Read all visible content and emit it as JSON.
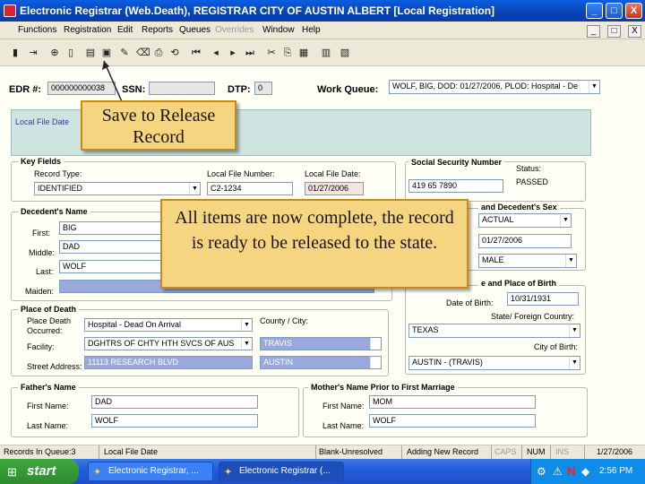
{
  "window": {
    "title": "Electronic Registrar (Web.Death), REGISTRAR   CITY OF AUSTIN   ALBERT   [Local Registration]",
    "min_label": "_",
    "max_label": "□",
    "close_label": "X",
    "mdi_min": "_",
    "mdi_max": "□",
    "mdi_close": "X"
  },
  "menu": [
    "Functions",
    "Registration",
    "Edit",
    "Reports",
    "Queues",
    "Overrides",
    "Window",
    "Help"
  ],
  "header": {
    "edr_label": "EDR #:",
    "edr_value": "000000000038",
    "ssn_label": "SSN:",
    "dtp_label": "DTP:",
    "dtp_value": "0",
    "work_queue_label": "Work Queue:",
    "work_queue_value": "WOLF, BIG, DOD: 01/27/2006, PLOD: Hospital - De"
  },
  "local_file_date_tab": "Local File Date",
  "key_fields": {
    "title": "Key Fields",
    "record_type_label": "Record Type:",
    "record_type_value": "IDENTIFIED",
    "local_file_number_label": "Local File Number:",
    "local_file_number_value": "C2-1234",
    "local_file_date_label": "Local File Date:",
    "local_file_date_value": "01/27/2006"
  },
  "ssn_group": {
    "title": "Social Security Number",
    "value": "419 65 7890",
    "status_label": "Status:",
    "status_value": "PASSED"
  },
  "decedent_name": {
    "title": "Decedent's Name",
    "first_label": "First:",
    "first_value": "BIG",
    "middle_label": "Middle:",
    "middle_value": "DAD",
    "last_label": "Last:",
    "last_value": "WOLF",
    "maiden_label": "Maiden:"
  },
  "sex_group": {
    "title": "and Decedent's Sex",
    "value1": "ACTUAL",
    "value2": "01/27/2006",
    "value3": "MALE"
  },
  "birth_group": {
    "title": "e and Place of Birth",
    "dob_label": "Date of Birth:",
    "dob_value": "10/31/1931",
    "state_label": "State/ Foreign Country:",
    "state_value": "TEXAS",
    "city_label": "City of Birth:",
    "city_value": "AUSTIN - (TRAVIS)"
  },
  "place_of_death": {
    "title": "Place of Death",
    "occurred_label": "Place Death Occurred:",
    "occurred_value": "Hospital - Dead On Arrival",
    "facility_label": "Facility:",
    "facility_value": "DGHTRS OF CHTY HTH SVCS OF AUS",
    "county_label": "County / City:",
    "county_value": "TRAVIS",
    "city_value": "AUSTIN",
    "street_label": "Street Address:",
    "street_value": "11113 RESEARCH BLVD"
  },
  "father": {
    "title": "Father's Name",
    "first_label": "First Name:",
    "first_value": "DAD",
    "last_label": "Last Name:",
    "last_value": "WOLF"
  },
  "mother": {
    "title": "Mother's Name Prior to First Marriage",
    "first_label": "First Name:",
    "first_value": "MOM",
    "last_label": "Last Name:",
    "last_value": "WOLF"
  },
  "status_bar": {
    "records": "Records In Queue:3",
    "local_file_date": "Local File Date",
    "blank": "Blank-Unresolved",
    "adding": "Adding New Record",
    "caps": "CAPS",
    "num": "NUM",
    "ins": "INS",
    "date": "1/27/2006"
  },
  "taskbar": {
    "start": "start",
    "task1": "Electronic Registrar, ...",
    "task2": "Electronic Registrar (...",
    "clock": "2:56 PM"
  },
  "callouts": {
    "save": "Save to Release Record",
    "complete": "All items are now complete, the record is ready to be released to the state."
  },
  "colors": {
    "titlebar": "#0a46c8",
    "callout_bg": "#f6d580",
    "callout_border": "#c98a14",
    "blue_field": "#99a9de"
  }
}
